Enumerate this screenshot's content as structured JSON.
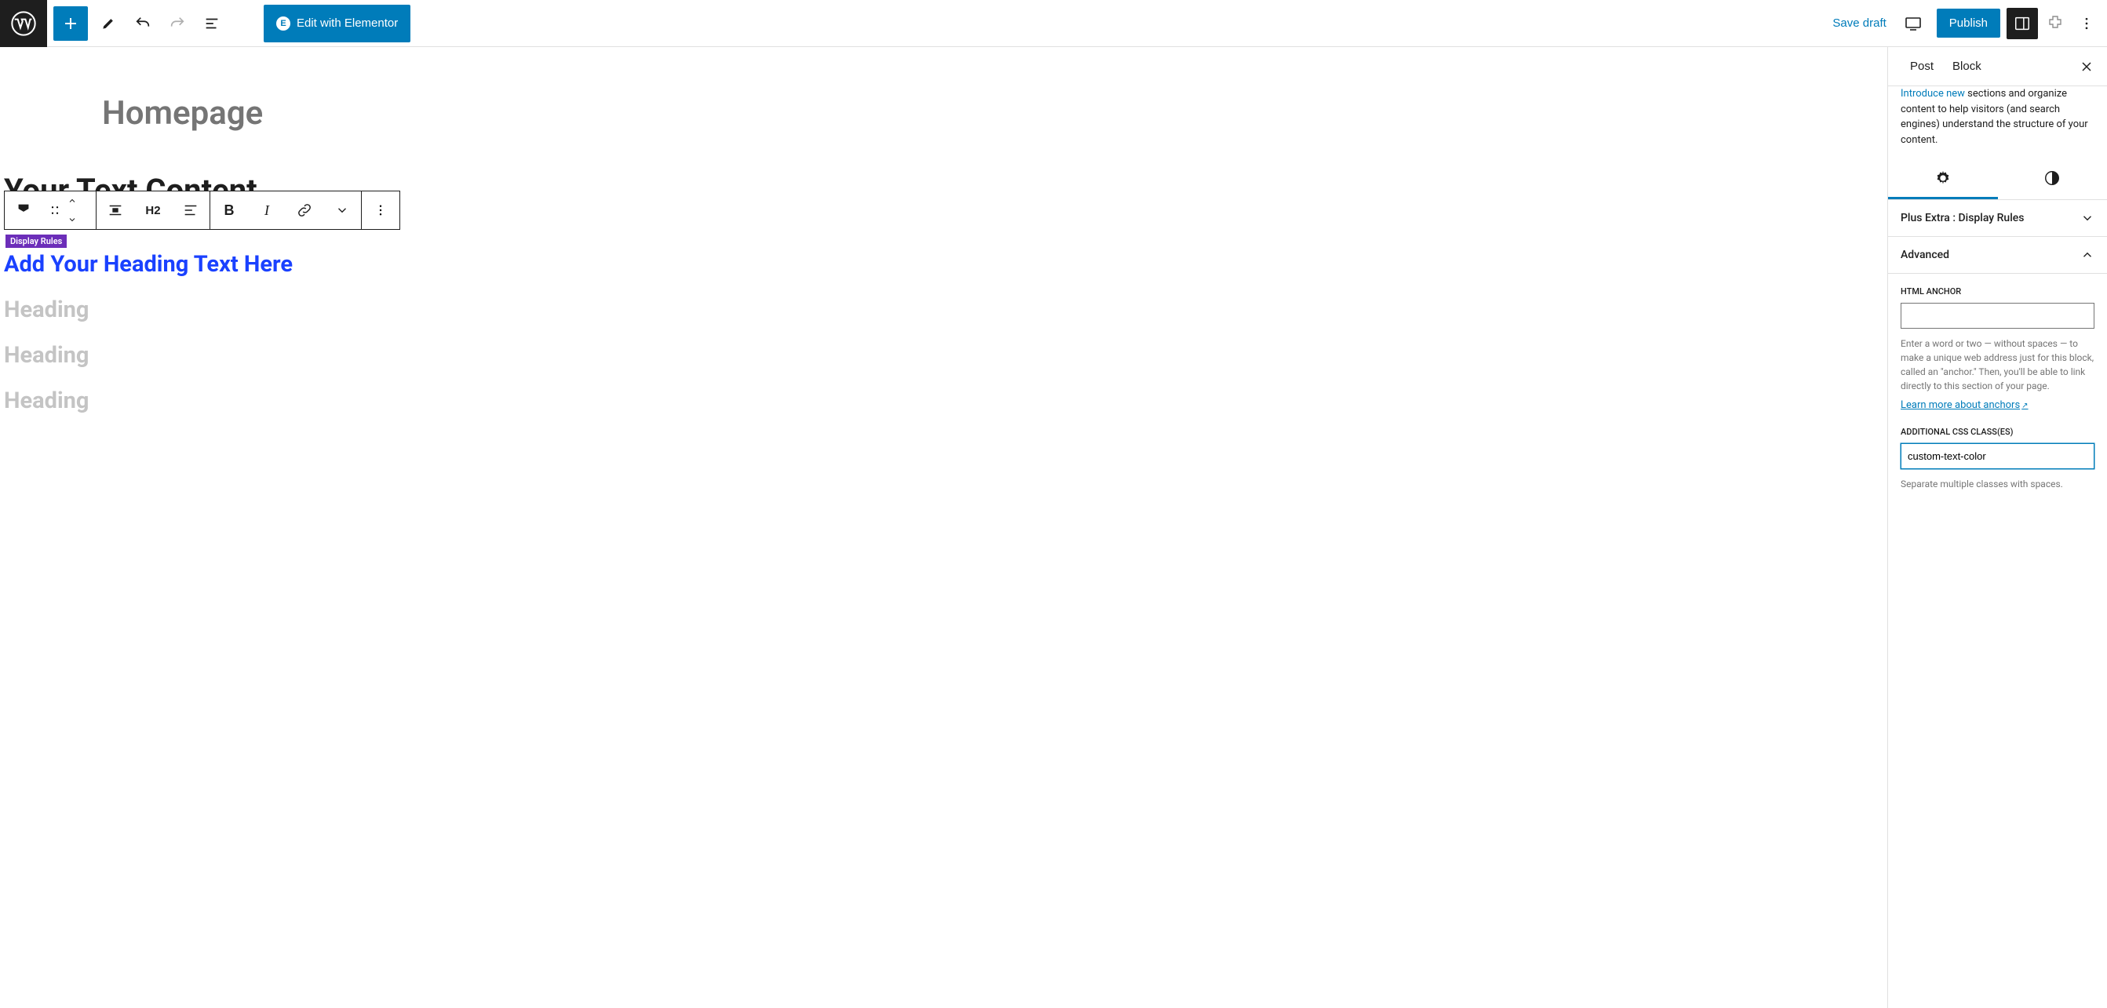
{
  "toolbar": {
    "elementor_label": "Edit with Elementor",
    "save_draft": "Save draft",
    "publish": "Publish"
  },
  "canvas": {
    "page_title": "Homepage",
    "content_block_text": "Your Text Content",
    "block_toolbar": {
      "heading_level": "H2"
    },
    "display_rules_badge": "Display Rules",
    "heading_selected": "Add Your Heading Text Here",
    "headings_gray": [
      "Heading",
      "Heading",
      "Heading"
    ]
  },
  "sidebar": {
    "tabs": {
      "post": "Post",
      "block": "Block"
    },
    "description_partial_1": "Introduce new",
    "description_partial_2": " sections and organize content to help visitors (and search engines) understand the structure of your content.",
    "panel_display_rules": "Plus Extra : Display Rules",
    "panel_advanced": "Advanced",
    "html_anchor": {
      "label": "HTML ANCHOR",
      "value": "",
      "help": "Enter a word or two — without spaces — to make a unique web address just for this block, called an \"anchor.\" Then, you'll be able to link directly to this section of your page.",
      "link_text": "Learn more about anchors"
    },
    "css_classes": {
      "label": "ADDITIONAL CSS CLASS(ES)",
      "value": "custom-text-color",
      "help": "Separate multiple classes with spaces."
    }
  }
}
